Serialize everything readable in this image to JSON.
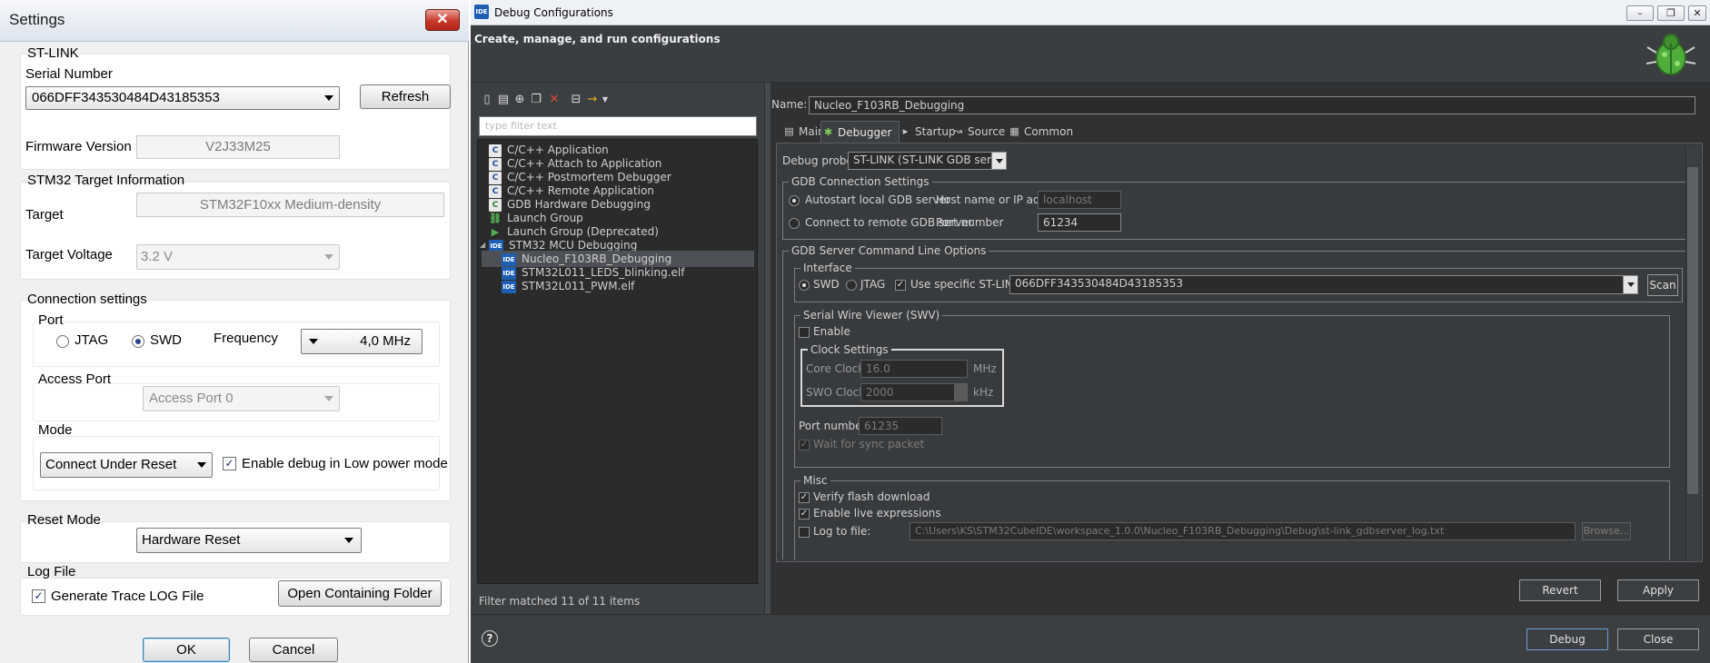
{
  "settings": {
    "title": "Settings",
    "close_glyph": "✕",
    "stlink": {
      "group_label": "ST-LINK",
      "serial_label": "Serial Number",
      "serial_value": "066DFF343530484D43185353",
      "refresh_label": "Refresh",
      "firmware_label": "Firmware Version",
      "firmware_value": "V2J33M25"
    },
    "target_info": {
      "group_label": "STM32 Target Information",
      "target_label": "Target",
      "target_value": "STM32F10xx Medium-density",
      "voltage_label": "Target Voltage",
      "voltage_value": "3.2 V"
    },
    "connection": {
      "group_label": "Connection settings",
      "port_label": "Port",
      "jtag_label": "JTAG",
      "swd_label": "SWD",
      "selected_port": "SWD",
      "frequency_label": "Frequency",
      "frequency_value": "4,0 MHz",
      "access_port_label": "Access Port",
      "access_port_value": "Access Port 0",
      "mode_label": "Mode",
      "mode_value": "Connect Under Reset",
      "low_power_label": "Enable debug in Low power mode",
      "low_power_checked": true
    },
    "reset": {
      "group_label": "Reset Mode",
      "value": "Hardware Reset"
    },
    "log": {
      "group_label": "Log File",
      "trace_label": "Generate Trace LOG File",
      "trace_checked": true,
      "open_folder_label": "Open Containing Folder"
    },
    "ok_label": "OK",
    "cancel_label": "Cancel"
  },
  "debug": {
    "app_badge": "IDE",
    "title": "Debug Configurations",
    "header_text": "Create, manage, and run configurations",
    "filter_placeholder": "type filter text",
    "tree": [
      {
        "label": "C/C++ Application",
        "icon": "c-icon",
        "glyph": "C",
        "level": 1
      },
      {
        "label": "C/C++ Attach to Application",
        "icon": "c-icon",
        "glyph": "C",
        "level": 1
      },
      {
        "label": "C/C++ Postmortem Debugger",
        "icon": "c-icon",
        "glyph": "C",
        "level": 1
      },
      {
        "label": "C/C++ Remote Application",
        "icon": "c-icon",
        "glyph": "C",
        "level": 1
      },
      {
        "label": "GDB Hardware Debugging",
        "icon": "gdb-icon",
        "glyph": "C",
        "level": 1
      },
      {
        "label": "Launch Group",
        "icon": "launch-group-icon",
        "glyph": "⛓",
        "level": 1
      },
      {
        "label": "Launch Group (Deprecated)",
        "icon": "launch-group-icon",
        "glyph": "▶",
        "level": 1
      },
      {
        "label": "STM32 MCU Debugging",
        "icon": "ide-icon",
        "glyph": "IDE",
        "level": 1,
        "expanded": true
      },
      {
        "label": "Nucleo_F103RB_Debugging",
        "icon": "ide-icon",
        "glyph": "IDE",
        "level": 2,
        "selected": true
      },
      {
        "label": "STM32L011_LEDS_blinking.elf",
        "icon": "ide-icon",
        "glyph": "IDE",
        "level": 2
      },
      {
        "label": "STM32L011_PWM.elf",
        "icon": "ide-icon",
        "glyph": "IDE",
        "level": 2
      }
    ],
    "filter_status": "Filter matched 11 of 11 items",
    "name_label": "Name:",
    "name_value": "Nucleo_F103RB_Debugging",
    "tabs": [
      {
        "label": "Main",
        "icon": "main-tab-icon",
        "glyph": "▤"
      },
      {
        "label": "Debugger",
        "icon": "debugger-tab-icon",
        "glyph": "✱",
        "active": true
      },
      {
        "label": "Startup",
        "icon": "startup-tab-icon",
        "glyph": "▸"
      },
      {
        "label": "Source",
        "icon": "source-tab-icon",
        "glyph": "↝"
      },
      {
        "label": "Common",
        "icon": "common-tab-icon",
        "glyph": "▦"
      }
    ],
    "debug_probe_label": "Debug probe",
    "debug_probe_value": "ST-LINK (ST-LINK GDB server)",
    "gdb_connection": {
      "group_label": "GDB Connection Settings",
      "autostart_label": "Autostart local GDB server",
      "remote_label": "Connect to remote GDB server",
      "selected": "autostart",
      "host_label": "Host name or IP address",
      "host_value": "localhost",
      "port_label": "Port number",
      "port_value": "61234"
    },
    "gdb_server_options": {
      "group_label": "GDB Server Command Line Options",
      "interface": {
        "group_label": "Interface",
        "swd_label": "SWD",
        "jtag_label": "JTAG",
        "selected": "SWD",
        "specific_sn_label": "Use specific ST-LINK S/N",
        "specific_sn_checked": true,
        "sn_value": "066DFF343530484D43185353",
        "scan_label": "Scan"
      },
      "swv": {
        "group_label": "Serial Wire Viewer (SWV)",
        "enable_label": "Enable",
        "enable_checked": false,
        "clock": {
          "group_label": "Clock Settings",
          "core_label": "Core Clock:",
          "core_value": "16.0",
          "core_unit": "MHz",
          "swo_label": "SWO Clock:",
          "swo_value": "2000",
          "swo_unit": "kHz"
        },
        "port_label": "Port number:",
        "port_value": "61235",
        "wait_sync_label": "Wait for sync packet",
        "wait_sync_checked": true
      },
      "misc": {
        "group_label": "Misc",
        "verify_label": "Verify flash download",
        "verify_checked": true,
        "live_expr_label": "Enable live expressions",
        "live_expr_checked": true,
        "log_label": "Log to file:",
        "log_checked": false,
        "log_path": "C:\\Users\\KS\\STM32CubeIDE\\workspace_1.0.0\\Nucleo_F103RB_Debugging\\Debug\\st-link_gdbserver_log.txt",
        "browse_label": "Browse..."
      }
    },
    "revert_label": "Revert",
    "apply_label": "Apply",
    "debug_label": "Debug",
    "close_label": "Close",
    "help_glyph": "?"
  }
}
